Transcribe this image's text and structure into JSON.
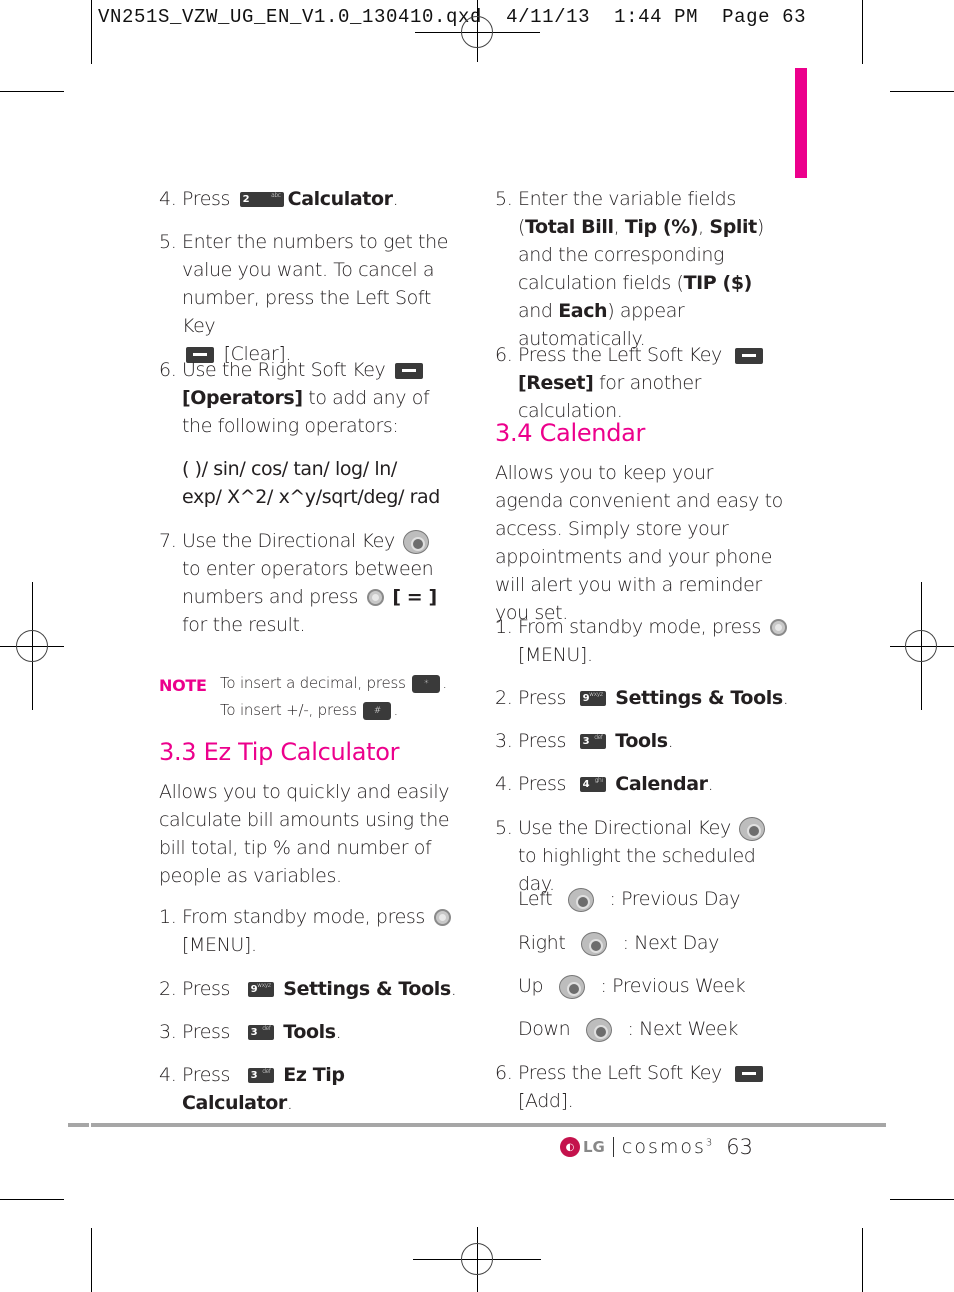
{
  "slug": {
    "filename": "VN251S_VZW_UG_EN_V1.0_130410.qxd",
    "date": "4/11/13",
    "time": "1:44 PM",
    "page_label": "Page 63"
  },
  "left_column": {
    "calc_step4": {
      "num": "4.",
      "pre": "Press",
      "key": {
        "digit": "2",
        "letters": "abc"
      },
      "target": "Calculator",
      "post": "."
    },
    "calc_step5": {
      "num": "5.",
      "text": "Enter the numbers to get the value you want. To cancel a number, press the Left Soft Key",
      "action": "[Clear]."
    },
    "calc_step6": {
      "num": "6.",
      "pre": "Use the Right Soft Key",
      "action": "[Operators]",
      "post": "to add any of the following operators:"
    },
    "operators_line1": "( )/ sin/ cos/ tan/ log/ ln/",
    "operators_line2": "exp/ X^2/ x^y/sqrt/deg/ rad",
    "calc_step7": {
      "num": "7.",
      "pre": "Use the Directional Key",
      "mid1": "to enter operators between numbers and press",
      "action": "[ = ]",
      "post": "for the result."
    },
    "note": {
      "label": "NOTE",
      "line1_pre": "To insert a decimal, press",
      "line1_key": "*",
      "line2_pre": "To insert +/-, press",
      "line2_key": "#"
    },
    "tip_heading": "3.3 Ez Tip Calculator",
    "tip_intro": "Allows you to quickly and easily calculate bill amounts using the bill total, tip % and number of people as variables.",
    "tip_steps": [
      {
        "num": "1.",
        "pre": "From standby mode, press",
        "action": "[MENU]."
      },
      {
        "num": "2.",
        "pre": "Press",
        "key": {
          "digit": "9",
          "letters": "wxyz"
        },
        "target": "Settings & Tools",
        "post": "."
      },
      {
        "num": "3.",
        "pre": "Press",
        "key": {
          "digit": "3",
          "letters": "def"
        },
        "target": "Tools",
        "post": "."
      },
      {
        "num": "4.",
        "pre": "Press",
        "key": {
          "digit": "3",
          "letters": "def"
        },
        "target": "Ez Tip Calculator",
        "post": "."
      }
    ]
  },
  "right_column": {
    "tip_step5": {
      "num": "5.",
      "pre": "Enter the variable fields (",
      "b1": "Total Bill",
      "s1": ", ",
      "b2": "Tip (%)",
      "s2": ", ",
      "b3": "Split",
      "mid": ") and the corresponding calculation fields (",
      "b4": "TIP ($)",
      "s3": " and ",
      "b5": "Each",
      "post": ") appear automatically."
    },
    "tip_step6": {
      "num": "6.",
      "pre": "Press the Left Soft Key",
      "action": "[Reset]",
      "post": "for another calculation."
    },
    "cal_heading": "3.4 Calendar",
    "cal_intro": "Allows you to keep your agenda convenient and easy to access. Simply store your appointments and your phone will alert you with a reminder you set.",
    "cal_steps": [
      {
        "num": "1.",
        "pre": "From standby mode, press",
        "action": "[MENU]."
      },
      {
        "num": "2.",
        "pre": "Press",
        "key": {
          "digit": "9",
          "letters": "wxyz"
        },
        "target": "Settings & Tools",
        "post": "."
      },
      {
        "num": "3.",
        "pre": "Press",
        "key": {
          "digit": "3",
          "letters": "def"
        },
        "target": "Tools",
        "post": "."
      },
      {
        "num": "4.",
        "pre": "Press",
        "key": {
          "digit": "4",
          "letters": "ghi"
        },
        "target": "Calendar",
        "post": "."
      },
      {
        "num": "5.",
        "pre": "Use the Directional Key",
        "post": "to highlight  the scheduled day."
      }
    ],
    "directions": [
      {
        "dir": "Left",
        "desc": ": Previous Day"
      },
      {
        "dir": "Right",
        "desc": ": Next Day"
      },
      {
        "dir": "Up",
        "desc": ": Previous Week"
      },
      {
        "dir": "Down",
        "desc": ": Next Week"
      }
    ],
    "cal_step6": {
      "num": "6.",
      "pre": "Press the Left Soft Key",
      "action": "[Add]."
    }
  },
  "footer": {
    "brand": "LG",
    "product": "COSMOS",
    "product_suffix": "3",
    "page_number": "63"
  },
  "colors": {
    "accent": "#ec008c",
    "rule": "#a6a6a6",
    "text": "#231f20"
  }
}
